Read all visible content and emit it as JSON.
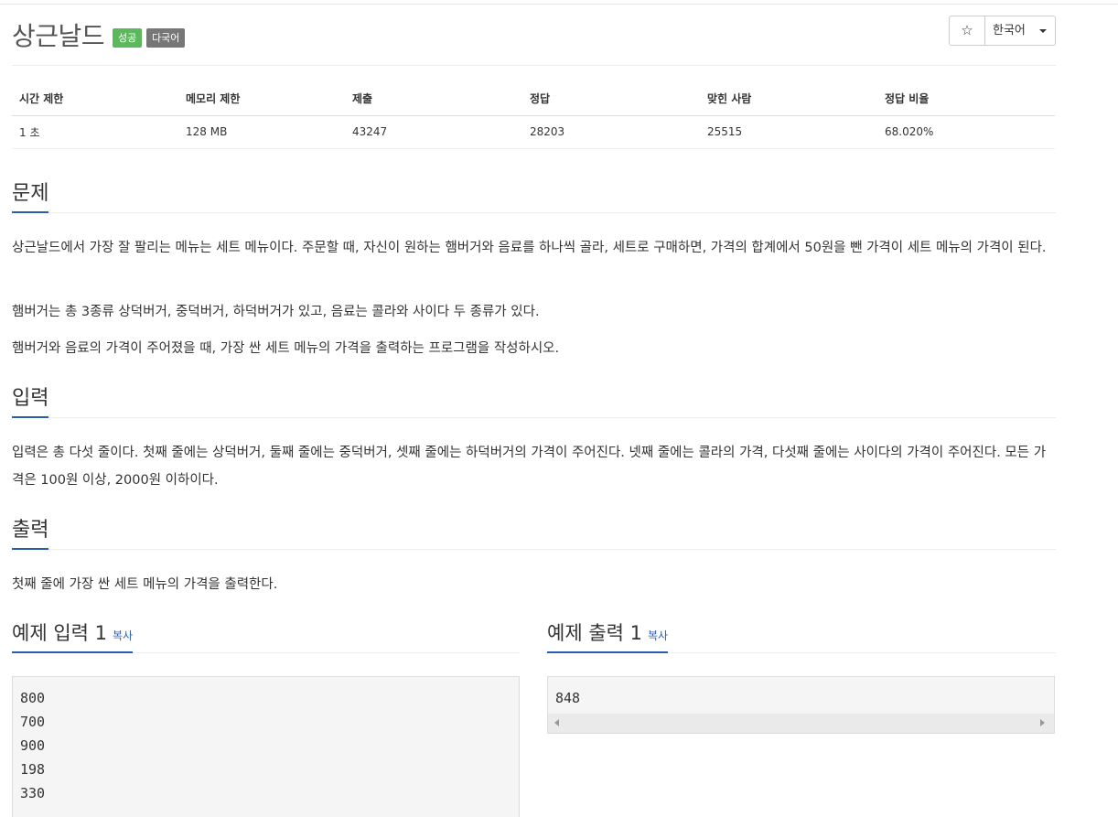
{
  "problem": {
    "title": "상근날드",
    "badges": {
      "success": "성공",
      "multilang": "다국어"
    },
    "star_icon": "★",
    "language": "한국어"
  },
  "stats": {
    "headers": [
      "시간 제한",
      "메모리 제한",
      "제출",
      "정답",
      "맞힌 사람",
      "정답 비율"
    ],
    "values": [
      "1 초",
      "128 MB",
      "43247",
      "28203",
      "25515",
      "68.020%"
    ]
  },
  "sections": {
    "description": {
      "heading": "문제",
      "paragraphs": [
        "상근날드에서 가장 잘 팔리는 메뉴는 세트 메뉴이다. 주문할 때, 자신이 원하는 햄버거와 음료를 하나씩 골라, 세트로 구매하면, 가격의 합계에서 50원을 뺀 가격이 세트 메뉴의 가격이 된다.",
        "햄버거는 총 3종류 상덕버거, 중덕버거, 하덕버거가 있고, 음료는 콜라와 사이다 두 종류가 있다.",
        "햄버거와 음료의 가격이 주어졌을 때, 가장 싼 세트 메뉴의 가격을 출력하는 프로그램을 작성하시오."
      ]
    },
    "input": {
      "heading": "입력",
      "text": "입력은 총 다섯 줄이다. 첫째 줄에는 상덕버거, 둘째 줄에는 중덕버거, 셋째 줄에는 하덕버거의 가격이 주어진다. 넷째 줄에는 콜라의 가격, 다섯째 줄에는 사이다의 가격이 주어진다. 모든 가격은 100원 이상, 2000원 이하이다."
    },
    "output": {
      "heading": "출력",
      "text": "첫째 줄에 가장 싼 세트 메뉴의 가격을 출력한다."
    }
  },
  "samples": {
    "input": {
      "heading": "예제 입력 1",
      "copy": "복사",
      "lines": [
        "800",
        "700",
        "900",
        "198",
        "330"
      ]
    },
    "output": {
      "heading": "예제 출력 1",
      "copy": "복사",
      "lines": [
        "848"
      ]
    }
  },
  "colors": {
    "accent": "#2a5db0",
    "success": "#5cb85c",
    "neutral_badge": "#777777"
  }
}
